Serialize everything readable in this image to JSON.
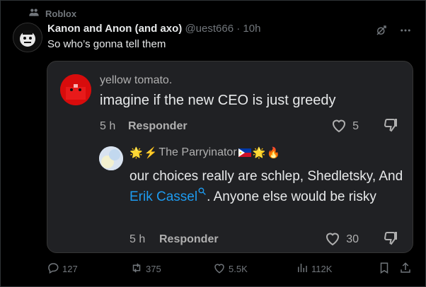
{
  "community": {
    "label": "Roblox",
    "icon": "community-icon"
  },
  "tweet": {
    "author_name": "Kanon and Anon (and axo)",
    "handle": "@uest666",
    "separator": "·",
    "time": "10h",
    "text": "So who’s gonna tell them"
  },
  "quoted": {
    "comment1": {
      "user": "yellow tomato.",
      "text": "imagine if the new CEO is just greedy",
      "time": "5 h",
      "reply_label": "Responder",
      "likes": "5"
    },
    "comment2": {
      "user": "The Parryinator",
      "text_before": "our choices really are schlep, Shedletsky, And ",
      "link": "Erik Cassel",
      "text_after": ". Anyone else would be risky",
      "time": "5 h",
      "reply_label": "Responder",
      "likes": "30"
    }
  },
  "actions": {
    "replies": "127",
    "reposts": "375",
    "likes": "5.5K",
    "views": "112K"
  },
  "colors": {
    "accent": "#1d9bf0",
    "muted": "#71767b",
    "card_bg": "#202124"
  }
}
